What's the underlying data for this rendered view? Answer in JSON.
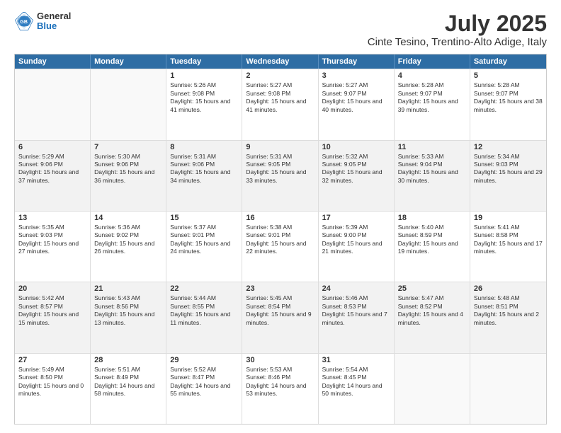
{
  "header": {
    "logo": {
      "line1": "General",
      "line2": "Blue"
    },
    "title": "July 2025",
    "subtitle": "Cinte Tesino, Trentino-Alto Adige, Italy"
  },
  "calendar": {
    "days_of_week": [
      "Sunday",
      "Monday",
      "Tuesday",
      "Wednesday",
      "Thursday",
      "Friday",
      "Saturday"
    ],
    "rows": [
      [
        {
          "day": "",
          "info": ""
        },
        {
          "day": "",
          "info": ""
        },
        {
          "day": "1",
          "info": "Sunrise: 5:26 AM\nSunset: 9:08 PM\nDaylight: 15 hours and 41 minutes."
        },
        {
          "day": "2",
          "info": "Sunrise: 5:27 AM\nSunset: 9:08 PM\nDaylight: 15 hours and 41 minutes."
        },
        {
          "day": "3",
          "info": "Sunrise: 5:27 AM\nSunset: 9:07 PM\nDaylight: 15 hours and 40 minutes."
        },
        {
          "day": "4",
          "info": "Sunrise: 5:28 AM\nSunset: 9:07 PM\nDaylight: 15 hours and 39 minutes."
        },
        {
          "day": "5",
          "info": "Sunrise: 5:28 AM\nSunset: 9:07 PM\nDaylight: 15 hours and 38 minutes."
        }
      ],
      [
        {
          "day": "6",
          "info": "Sunrise: 5:29 AM\nSunset: 9:06 PM\nDaylight: 15 hours and 37 minutes."
        },
        {
          "day": "7",
          "info": "Sunrise: 5:30 AM\nSunset: 9:06 PM\nDaylight: 15 hours and 36 minutes."
        },
        {
          "day": "8",
          "info": "Sunrise: 5:31 AM\nSunset: 9:06 PM\nDaylight: 15 hours and 34 minutes."
        },
        {
          "day": "9",
          "info": "Sunrise: 5:31 AM\nSunset: 9:05 PM\nDaylight: 15 hours and 33 minutes."
        },
        {
          "day": "10",
          "info": "Sunrise: 5:32 AM\nSunset: 9:05 PM\nDaylight: 15 hours and 32 minutes."
        },
        {
          "day": "11",
          "info": "Sunrise: 5:33 AM\nSunset: 9:04 PM\nDaylight: 15 hours and 30 minutes."
        },
        {
          "day": "12",
          "info": "Sunrise: 5:34 AM\nSunset: 9:03 PM\nDaylight: 15 hours and 29 minutes."
        }
      ],
      [
        {
          "day": "13",
          "info": "Sunrise: 5:35 AM\nSunset: 9:03 PM\nDaylight: 15 hours and 27 minutes."
        },
        {
          "day": "14",
          "info": "Sunrise: 5:36 AM\nSunset: 9:02 PM\nDaylight: 15 hours and 26 minutes."
        },
        {
          "day": "15",
          "info": "Sunrise: 5:37 AM\nSunset: 9:01 PM\nDaylight: 15 hours and 24 minutes."
        },
        {
          "day": "16",
          "info": "Sunrise: 5:38 AM\nSunset: 9:01 PM\nDaylight: 15 hours and 22 minutes."
        },
        {
          "day": "17",
          "info": "Sunrise: 5:39 AM\nSunset: 9:00 PM\nDaylight: 15 hours and 21 minutes."
        },
        {
          "day": "18",
          "info": "Sunrise: 5:40 AM\nSunset: 8:59 PM\nDaylight: 15 hours and 19 minutes."
        },
        {
          "day": "19",
          "info": "Sunrise: 5:41 AM\nSunset: 8:58 PM\nDaylight: 15 hours and 17 minutes."
        }
      ],
      [
        {
          "day": "20",
          "info": "Sunrise: 5:42 AM\nSunset: 8:57 PM\nDaylight: 15 hours and 15 minutes."
        },
        {
          "day": "21",
          "info": "Sunrise: 5:43 AM\nSunset: 8:56 PM\nDaylight: 15 hours and 13 minutes."
        },
        {
          "day": "22",
          "info": "Sunrise: 5:44 AM\nSunset: 8:55 PM\nDaylight: 15 hours and 11 minutes."
        },
        {
          "day": "23",
          "info": "Sunrise: 5:45 AM\nSunset: 8:54 PM\nDaylight: 15 hours and 9 minutes."
        },
        {
          "day": "24",
          "info": "Sunrise: 5:46 AM\nSunset: 8:53 PM\nDaylight: 15 hours and 7 minutes."
        },
        {
          "day": "25",
          "info": "Sunrise: 5:47 AM\nSunset: 8:52 PM\nDaylight: 15 hours and 4 minutes."
        },
        {
          "day": "26",
          "info": "Sunrise: 5:48 AM\nSunset: 8:51 PM\nDaylight: 15 hours and 2 minutes."
        }
      ],
      [
        {
          "day": "27",
          "info": "Sunrise: 5:49 AM\nSunset: 8:50 PM\nDaylight: 15 hours and 0 minutes."
        },
        {
          "day": "28",
          "info": "Sunrise: 5:51 AM\nSunset: 8:49 PM\nDaylight: 14 hours and 58 minutes."
        },
        {
          "day": "29",
          "info": "Sunrise: 5:52 AM\nSunset: 8:47 PM\nDaylight: 14 hours and 55 minutes."
        },
        {
          "day": "30",
          "info": "Sunrise: 5:53 AM\nSunset: 8:46 PM\nDaylight: 14 hours and 53 minutes."
        },
        {
          "day": "31",
          "info": "Sunrise: 5:54 AM\nSunset: 8:45 PM\nDaylight: 14 hours and 50 minutes."
        },
        {
          "day": "",
          "info": ""
        },
        {
          "day": "",
          "info": ""
        }
      ]
    ]
  }
}
